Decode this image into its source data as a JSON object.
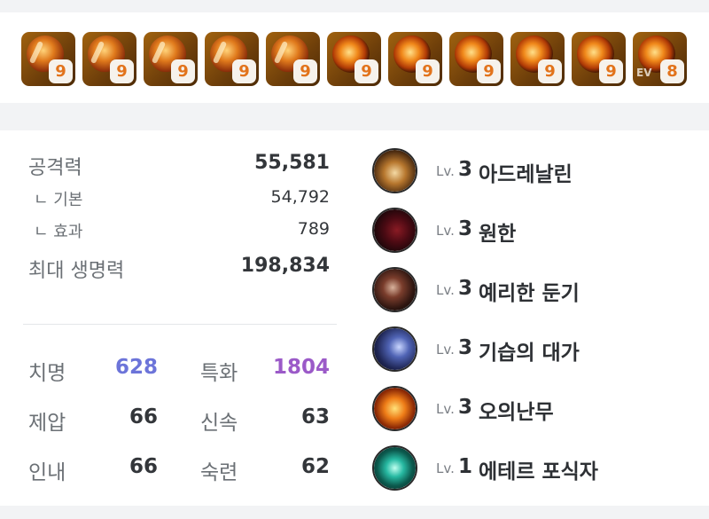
{
  "gems": [
    {
      "level": "9",
      "type": "a",
      "badge": ""
    },
    {
      "level": "9",
      "type": "a",
      "badge": ""
    },
    {
      "level": "9",
      "type": "a",
      "badge": ""
    },
    {
      "level": "9",
      "type": "a",
      "badge": ""
    },
    {
      "level": "9",
      "type": "a",
      "badge": ""
    },
    {
      "level": "9",
      "type": "b",
      "badge": ""
    },
    {
      "level": "9",
      "type": "b",
      "badge": ""
    },
    {
      "level": "9",
      "type": "b",
      "badge": ""
    },
    {
      "level": "9",
      "type": "b",
      "badge": ""
    },
    {
      "level": "9",
      "type": "b",
      "badge": ""
    },
    {
      "level": "8",
      "type": "b",
      "badge": "EV"
    }
  ],
  "attack": {
    "label": "공격력",
    "value": "55,581",
    "base_label": "ㄴ 기본",
    "base_value": "54,792",
    "effect_label": "ㄴ 효과",
    "effect_value": "789"
  },
  "hp": {
    "label": "최대 생명력",
    "value": "198,834"
  },
  "combat_stats": [
    {
      "l1": "치명",
      "v1": "628",
      "l2": "특화",
      "v2": "1804"
    },
    {
      "l1": "제압",
      "v1": "66",
      "l2": "신속",
      "v2": "63"
    },
    {
      "l1": "인내",
      "v1": "66",
      "l2": "숙련",
      "v2": "62"
    }
  ],
  "colors": {
    "crit": "#6c74d9",
    "spec": "#9b5ac8",
    "gem_level": "#e2731b"
  },
  "engravings": [
    {
      "prefix": "Lv.",
      "level": "3",
      "name": "아드레날린",
      "icon": "adrenaline-icon"
    },
    {
      "prefix": "Lv.",
      "level": "3",
      "name": "원한",
      "icon": "grudge-icon"
    },
    {
      "prefix": "Lv.",
      "level": "3",
      "name": "예리한 둔기",
      "icon": "keen-blunt-weapon-icon"
    },
    {
      "prefix": "Lv.",
      "level": "3",
      "name": "기습의 대가",
      "icon": "master-of-ambush-icon"
    },
    {
      "prefix": "Lv.",
      "level": "3",
      "name": "오의난무",
      "icon": "esoteric-flurry-icon"
    },
    {
      "prefix": "Lv.",
      "level": "1",
      "name": "에테르 포식자",
      "icon": "ether-predator-icon"
    }
  ]
}
